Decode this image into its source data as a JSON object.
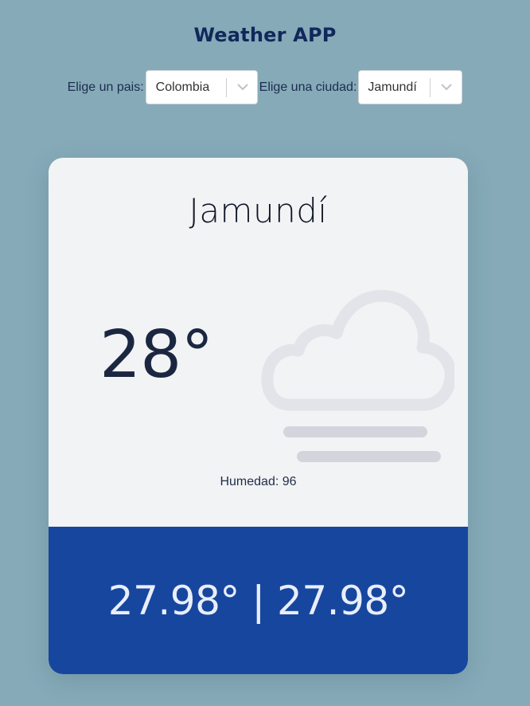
{
  "app": {
    "title": "Weather APP"
  },
  "selectors": {
    "country": {
      "label": "Elige un pais:",
      "value": "Colombia"
    },
    "city": {
      "label": "Elige una ciudad:",
      "value": "Jamundí"
    }
  },
  "weather": {
    "city": "Jamundí",
    "temperature": "28°",
    "icon": "fog-cloud-icon",
    "humidity_text": "Humedad: 96",
    "min_max_text": "27.98° | 27.98°"
  },
  "colors": {
    "background": "#86aab8",
    "card": "#f2f3f5",
    "footer": "#17469e",
    "title": "#10285a"
  }
}
